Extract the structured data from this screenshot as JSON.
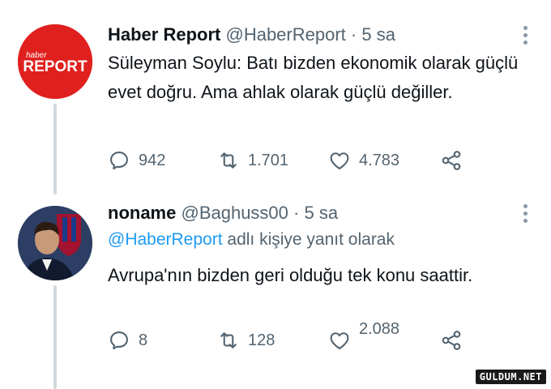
{
  "tweets": [
    {
      "name": "Haber Report",
      "handle": "@HaberReport",
      "separator": "·",
      "time": "5 sa",
      "text": "Süleyman Soylu: Batı bizden ekonomik olarak güçlü evet doğru. Ama ahlak olarak güçlü değiller.",
      "avatar_logo_small": "haber",
      "avatar_logo_big": "REPORT",
      "actions": {
        "replies": "942",
        "retweets": "1.701",
        "likes": "4.783"
      }
    },
    {
      "name": "noname",
      "handle": "@Baghuss00",
      "separator": "·",
      "time": "5 sa",
      "reply_mention": "@HaberReport",
      "reply_suffix": "adlı kişiye yanıt olarak",
      "text": "Avrupa'nın bizden geri olduğu tek konu saattir.",
      "actions": {
        "replies": "8",
        "retweets": "128",
        "likes": "2.088"
      }
    }
  ],
  "icons": {
    "reply": "speech-bubble-icon",
    "retweet": "retweet-icon",
    "like": "heart-icon",
    "share": "share-icon",
    "more": "more-vertical-icon"
  },
  "colors": {
    "accent": "#1d9bf0",
    "secondary_text": "#536471",
    "brand_red": "#e0201e"
  },
  "watermark": "GULDUM.NET"
}
